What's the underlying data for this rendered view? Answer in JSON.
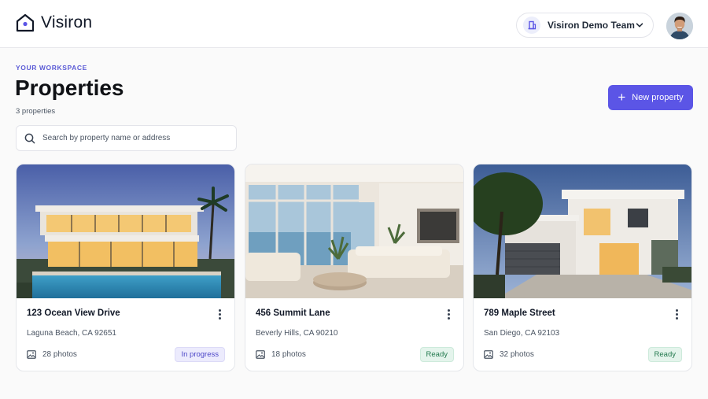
{
  "app": {
    "name": "Visiron"
  },
  "header": {
    "team_name": "Visiron Demo Team"
  },
  "page": {
    "eyebrow": "YOUR WORKSPACE",
    "title": "Properties",
    "count": "3 properties",
    "new_button": "New property",
    "search_placeholder": "Search by property name or address"
  },
  "theme": {
    "accent": "#5b55e6",
    "progress_badge": "#ecebfd",
    "ready_badge": "#e4f4ec"
  },
  "properties": [
    {
      "title": "123 Ocean View Drive",
      "address": "Laguna Beach, CA 92651",
      "photos": "28 photos",
      "status": "In progress"
    },
    {
      "title": "456 Summit Lane",
      "address": "Beverly Hills, CA 90210",
      "photos": "18 photos",
      "status": "Ready"
    },
    {
      "title": "789 Maple Street",
      "address": "San Diego, CA 92103",
      "photos": "32 photos",
      "status": "Ready"
    }
  ]
}
